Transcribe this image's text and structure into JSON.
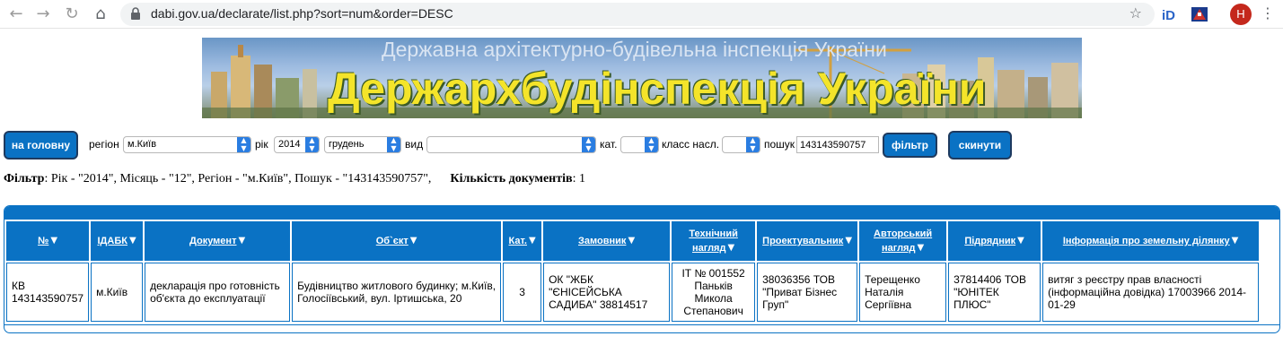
{
  "browser": {
    "url": "dabi.gov.ua/declarate/list.php?sort=num&order=DESC",
    "avatar_letter": "Н"
  },
  "banner": {
    "subtitle": "Державна архітектурно-будівельна інспекція України",
    "title": "Держархбудінспекція України"
  },
  "filters": {
    "home_button": "на головну",
    "region_label": "регіон",
    "region_value": "м.Київ",
    "year_label": "рік",
    "year_value": "2014",
    "month_value": "грудень",
    "type_label": "вид",
    "type_value": "",
    "cat_label": "кат.",
    "cat_value": "",
    "class_label": "класс насл.",
    "class_value": "",
    "search_label": "пошук",
    "search_value": "143143590757",
    "filter_button": "фільтр",
    "reset_button": "скинути"
  },
  "summary": {
    "filter_label": "Фільтр",
    "filter_text": ": Рік - \"2014\", Місяць - \"12\", Регіон - \"м.Київ\", Пошук - \"143143590757\",",
    "count_label": "Кількість документів",
    "count_value": ": 1"
  },
  "table": {
    "headers": [
      "№",
      "ІДАБК",
      "Документ",
      "Об`єкт",
      "Кат.",
      "Замовник",
      "Технічний нагляд",
      "Проектувальник",
      "Авторський нагляд",
      "Підрядник",
      "Інформація про земельну ділянку"
    ],
    "row": {
      "num": "КВ 143143590757",
      "idabk": "м.Київ",
      "document": "декларація про готовність об'єкта до експлуатації",
      "object": "Будівництво житлового будинку; м.Київ, Голосіївський, вул. Іртишська, 20",
      "cat": "3",
      "customer": "ОК \"ЖБК \"ЄНІСЕЙСЬКА САДИБА\" 38814517",
      "tech_supervision": "ІТ № 001552 Паньків Микола Степанович",
      "designer": "38036356 ТОВ \"Приват Бізнес Груп\"",
      "author_supervision": "Терещенко Наталія Сергіївна",
      "contractor": "37814406 ТОВ \"ЮНІТЕК ПЛЮС\"",
      "land_info": "витяг з реєстру прав власності (інформаційна довідка) 17003966 2014-01-29"
    }
  },
  "colors": {
    "accent": "#0a72c4",
    "banner_title": "#f4e42a"
  }
}
